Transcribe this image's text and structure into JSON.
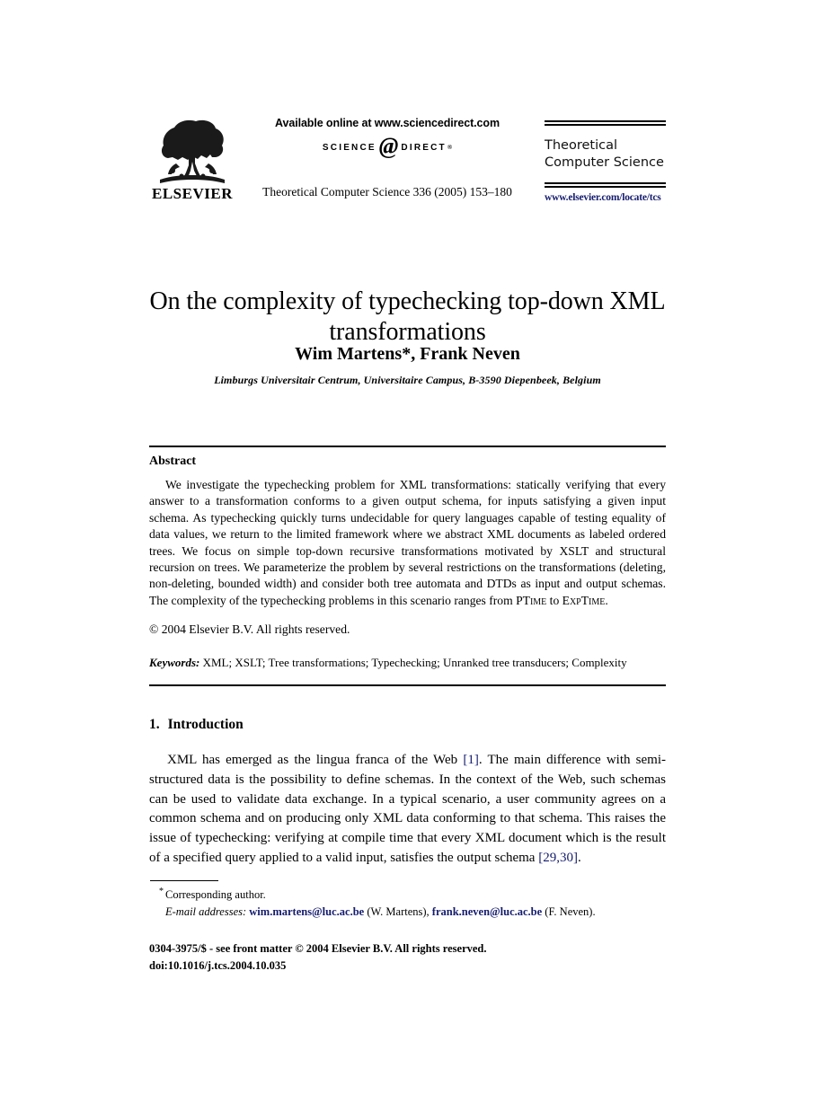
{
  "masthead": {
    "publisher_logo_word": "ELSEVIER",
    "sciencedirect_available": "Available online at www.sciencedirect.com",
    "sciencedirect_logo_left": "SCIENCE",
    "sciencedirect_logo_at": "@",
    "sciencedirect_logo_right": "DIRECT",
    "sciencedirect_logo_reg": "®",
    "journal_citation": "Theoretical Computer Science 336 (2005) 153–180",
    "journal_title_line1": "Theoretical",
    "journal_title_line2": "Computer Science",
    "journal_url": "www.elsevier.com/locate/tcs"
  },
  "article": {
    "title": "On the complexity of typechecking top-down XML transformations",
    "authors": "Wim Martens*, Frank Neven",
    "affiliation": "Limburgs Universitair Centrum, Universitaire Campus, B-3590 Diepenbeek, Belgium"
  },
  "abstract": {
    "heading": "Abstract",
    "body_part1": "We investigate the typechecking problem for XML transformations: statically verifying that every answer to a transformation conforms to a given output schema, for inputs satisfying a given input schema. As typechecking quickly turns undecidable for query languages capable of testing equality of data values, we return to the limited framework where we abstract XML documents as labeled ordered trees. We focus on simple top-down recursive transformations motivated by XSLT and structural recursion on trees. We parameterize the problem by several restrictions on the transformations (deleting, non-deleting, bounded width) and consider both tree automata and DTDs as input and output schemas. The complexity of the typechecking problems in this scenario ranges from ",
    "complexity_low": "PTime",
    "body_part2": " to ",
    "complexity_high": "ExpTime",
    "body_part3": ".",
    "copyright": "© 2004 Elsevier B.V. All rights reserved.",
    "keywords_label": "Keywords:",
    "keywords_value": " XML; XSLT; Tree transformations; Typechecking; Unranked tree transducers; Complexity"
  },
  "introduction": {
    "number": "1.",
    "heading": "Introduction",
    "text_part1": "XML has emerged as the lingua franca of the Web ",
    "cite1": "[1]",
    "text_part2": ". The main difference with semi-structured data is the possibility to define schemas. In the context of the Web, such schemas can be used to validate data exchange. In a typical scenario, a user community agrees on a common schema and on producing only XML data conforming to that schema. This raises the issue of typechecking: verifying at compile time that every XML document which is the result of a specified query applied to a valid input, satisfies the output schema ",
    "cite2": "[29,30]",
    "text_part3": "."
  },
  "footnotes": {
    "corresponding_star": "*",
    "corresponding_text": "Corresponding author.",
    "email_label": "E-mail addresses:",
    "email1": "wim.martens@luc.ac.be",
    "email1_owner": " (W. Martens), ",
    "email2": "frank.neven@luc.ac.be",
    "email2_owner": " (F. Neven).",
    "imprint_line1": "0304-3975/$ - see front matter © 2004 Elsevier B.V. All rights reserved.",
    "imprint_line2": "doi:10.1016/j.tcs.2004.10.035"
  },
  "colors": {
    "link": "#151c6e",
    "text": "#000000",
    "background": "#ffffff"
  }
}
